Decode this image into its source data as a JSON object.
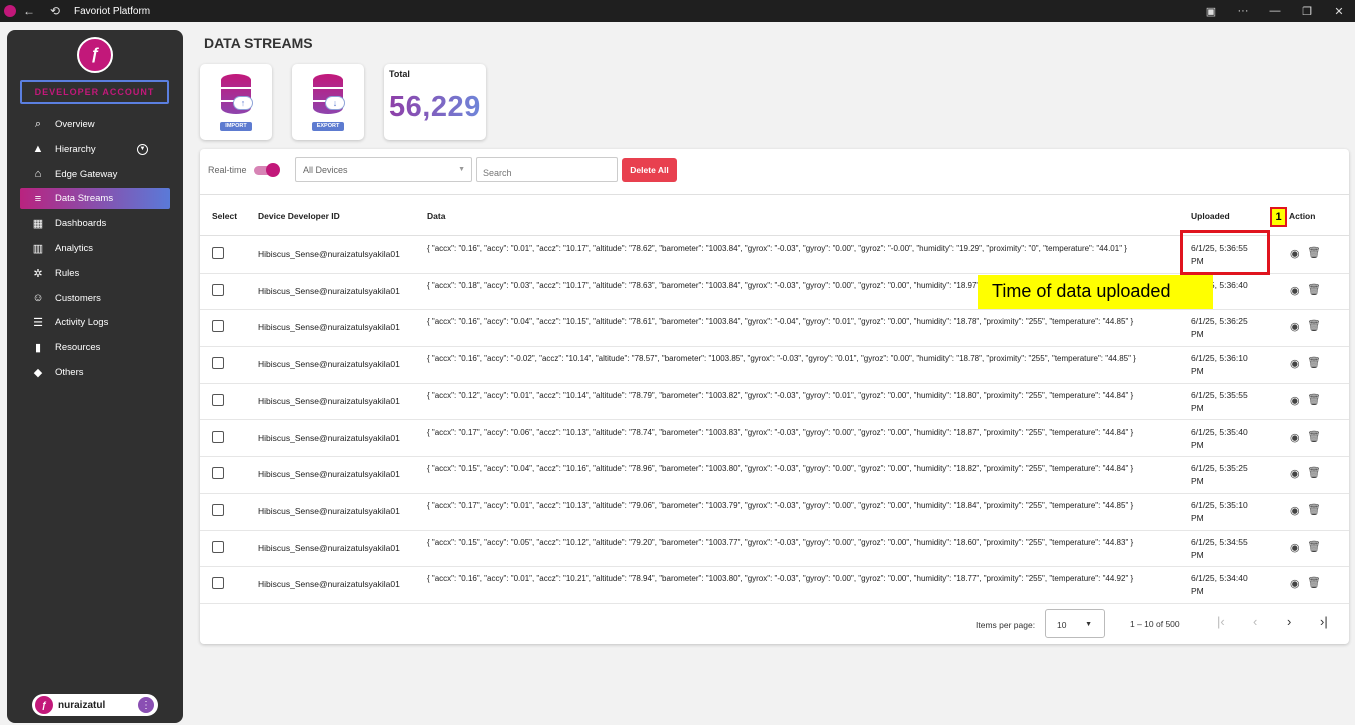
{
  "window": {
    "title": "Favoriot Platform",
    "back_icon": "←",
    "refresh_icon": "⟲",
    "controls": [
      "▣",
      "···",
      "—",
      "❐",
      "✕"
    ]
  },
  "sidebar": {
    "account_label": "DEVELOPER ACCOUNT",
    "items": [
      {
        "label": "Overview",
        "icon": "search-icon",
        "glyph": "⌕"
      },
      {
        "label": "Hierarchy",
        "icon": "hierarchy-icon",
        "glyph": "▲"
      },
      {
        "label": "Edge Gateway",
        "icon": "router-icon",
        "glyph": "⌂"
      },
      {
        "label": "Data Streams",
        "icon": "database-icon",
        "glyph": "≡"
      },
      {
        "label": "Dashboards",
        "icon": "dashboard-icon",
        "glyph": "▦"
      },
      {
        "label": "Analytics",
        "icon": "analytics-icon",
        "glyph": "▥"
      },
      {
        "label": "Rules",
        "icon": "rules-gear-icon",
        "glyph": "✲"
      },
      {
        "label": "Customers",
        "icon": "customers-icon",
        "glyph": "☺"
      },
      {
        "label": "Activity Logs",
        "icon": "activity-logs-icon",
        "glyph": "☰"
      },
      {
        "label": "Resources",
        "icon": "resources-book-icon",
        "glyph": "▮"
      },
      {
        "label": "Others",
        "icon": "tag-icon",
        "glyph": "◆"
      }
    ],
    "active_item": "Data Streams",
    "user_name": "nuraizatul",
    "user_more": "⋮"
  },
  "page": {
    "title": "DATA STREAMS",
    "import_label": "IMPORT",
    "export_label": "EXPORT",
    "total_label": "Total",
    "total_value": "56,229"
  },
  "toolbar": {
    "realtime_label": "Real-time",
    "realtime_on": true,
    "device_select_value": "All Devices",
    "search_placeholder": "Search",
    "delete_all_label": "Delete All"
  },
  "table": {
    "columns": [
      "Select",
      "Device Developer ID",
      "Data",
      "Uploaded",
      "Action"
    ],
    "rows": [
      {
        "device": "Hibiscus_Sense@nuraizatulsyakila01",
        "data": "{ \"accx\": \"0.16\", \"accy\": \"0.01\", \"accz\": \"10.17\", \"altitude\": \"78.62\", \"barometer\": \"1003.84\", \"gyrox\": \"-0.03\", \"gyroy\": \"0.00\", \"gyroz\": \"-0.00\", \"humidity\": \"19.29\", \"proximity\": \"0\", \"temperature\": \"44.01\" }",
        "uploaded": "6/1/25, 5:36:55 PM"
      },
      {
        "device": "Hibiscus_Sense@nuraizatulsyakila01",
        "data": "{ \"accx\": \"0.18\", \"accy\": \"0.03\", \"accz\": \"10.17\", \"altitude\": \"78.63\", \"barometer\": \"1003.84\", \"gyrox\": \"-0.03\", \"gyroy\": \"0.00\", \"gyroz\": \"0.00\", \"humidity\": \"18.97\", \"proximity\": \"255\", \"temperature\": \"44.81\" }",
        "uploaded": "6/1/25, 5:36:40 PM"
      },
      {
        "device": "Hibiscus_Sense@nuraizatulsyakila01",
        "data": "{ \"accx\": \"0.16\", \"accy\": \"0.04\", \"accz\": \"10.15\", \"altitude\": \"78.61\", \"barometer\": \"1003.84\", \"gyrox\": \"-0.04\", \"gyroy\": \"0.01\", \"gyroz\": \"0.00\", \"humidity\": \"18.78\", \"proximity\": \"255\", \"temperature\": \"44.85\" }",
        "uploaded": "6/1/25, 5:36:25 PM"
      },
      {
        "device": "Hibiscus_Sense@nuraizatulsyakila01",
        "data": "{ \"accx\": \"0.16\", \"accy\": \"-0.02\", \"accz\": \"10.14\", \"altitude\": \"78.57\", \"barometer\": \"1003.85\", \"gyrox\": \"-0.03\", \"gyroy\": \"0.01\", \"gyroz\": \"0.00\", \"humidity\": \"18.78\", \"proximity\": \"255\", \"temperature\": \"44.85\" }",
        "uploaded": "6/1/25, 5:36:10 PM"
      },
      {
        "device": "Hibiscus_Sense@nuraizatulsyakila01",
        "data": "{ \"accx\": \"0.12\", \"accy\": \"0.01\", \"accz\": \"10.14\", \"altitude\": \"78.79\", \"barometer\": \"1003.82\", \"gyrox\": \"-0.03\", \"gyroy\": \"0.01\", \"gyroz\": \"0.00\", \"humidity\": \"18.80\", \"proximity\": \"255\", \"temperature\": \"44.84\" }",
        "uploaded": "6/1/25, 5:35:55 PM"
      },
      {
        "device": "Hibiscus_Sense@nuraizatulsyakila01",
        "data": "{ \"accx\": \"0.17\", \"accy\": \"0.06\", \"accz\": \"10.13\", \"altitude\": \"78.74\", \"barometer\": \"1003.83\", \"gyrox\": \"-0.03\", \"gyroy\": \"0.00\", \"gyroz\": \"0.00\", \"humidity\": \"18.87\", \"proximity\": \"255\", \"temperature\": \"44.84\" }",
        "uploaded": "6/1/25, 5:35:40 PM"
      },
      {
        "device": "Hibiscus_Sense@nuraizatulsyakila01",
        "data": "{ \"accx\": \"0.15\", \"accy\": \"0.04\", \"accz\": \"10.16\", \"altitude\": \"78.96\", \"barometer\": \"1003.80\", \"gyrox\": \"-0.03\", \"gyroy\": \"0.00\", \"gyroz\": \"0.00\", \"humidity\": \"18.82\", \"proximity\": \"255\", \"temperature\": \"44.84\" }",
        "uploaded": "6/1/25, 5:35:25 PM"
      },
      {
        "device": "Hibiscus_Sense@nuraizatulsyakila01",
        "data": "{ \"accx\": \"0.17\", \"accy\": \"0.01\", \"accz\": \"10.13\", \"altitude\": \"79.06\", \"barometer\": \"1003.79\", \"gyrox\": \"-0.03\", \"gyroy\": \"0.00\", \"gyroz\": \"0.00\", \"humidity\": \"18.84\", \"proximity\": \"255\", \"temperature\": \"44.85\" }",
        "uploaded": "6/1/25, 5:35:10 PM"
      },
      {
        "device": "Hibiscus_Sense@nuraizatulsyakila01",
        "data": "{ \"accx\": \"0.15\", \"accy\": \"0.05\", \"accz\": \"10.12\", \"altitude\": \"79.20\", \"barometer\": \"1003.77\", \"gyrox\": \"-0.03\", \"gyroy\": \"0.00\", \"gyroz\": \"0.00\", \"humidity\": \"18.60\", \"proximity\": \"255\", \"temperature\": \"44.83\" }",
        "uploaded": "6/1/25, 5:34:55 PM"
      },
      {
        "device": "Hibiscus_Sense@nuraizatulsyakila01",
        "data": "{ \"accx\": \"0.16\", \"accy\": \"0.01\", \"accz\": \"10.21\", \"altitude\": \"78.94\", \"barometer\": \"1003.80\", \"gyrox\": \"-0.03\", \"gyroy\": \"0.00\", \"gyroz\": \"0.00\", \"humidity\": \"18.77\", \"proximity\": \"255\", \"temperature\": \"44.92\" }",
        "uploaded": "6/1/25, 5:34:40 PM"
      }
    ]
  },
  "pagination": {
    "items_per_page_label": "Items per page:",
    "items_per_page_value": "10",
    "range_label": "1 – 10 of 500"
  },
  "annotation": {
    "badge": "1",
    "callout": "Time of data uploaded"
  },
  "colors": {
    "brand": "#c2187a",
    "accent_blue": "#5d7bd0",
    "danger": "#e8404f",
    "highlight": "#ffff00",
    "annotation_red": "#e0141e"
  }
}
